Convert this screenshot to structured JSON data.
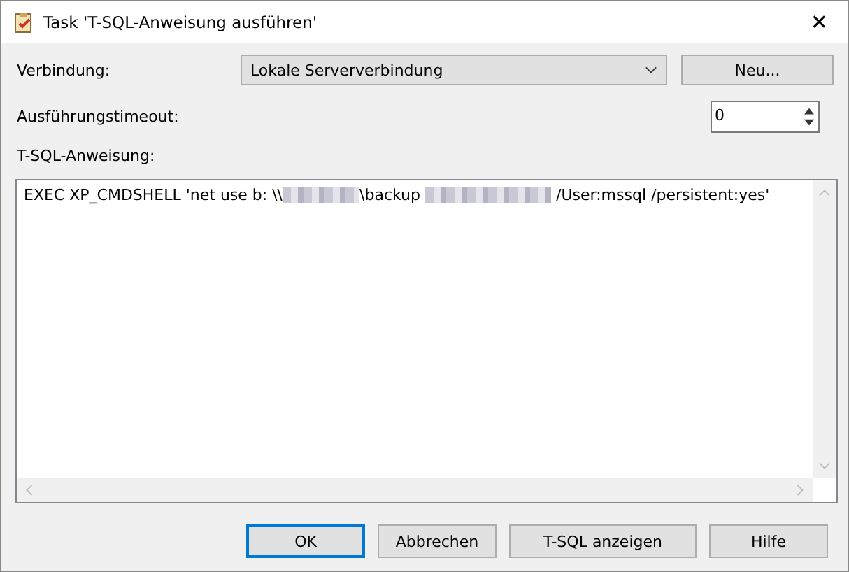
{
  "window": {
    "title": "Task 'T-SQL-Anweisung ausführen'",
    "close": "✕"
  },
  "connection": {
    "label": "Verbindung:",
    "value": "Lokale Serververbindung",
    "new_button": "Neu..."
  },
  "timeout": {
    "label": "Ausführungstimeout:",
    "value": "0"
  },
  "statement": {
    "label": "T-SQL-Anweisung:",
    "segments": [
      {
        "kind": "text",
        "text": "EXEC XP_CMDSHELL 'net use b: \\\\"
      },
      {
        "kind": "redacted"
      },
      {
        "kind": "text",
        "text": "\\backup "
      },
      {
        "kind": "redacted"
      },
      {
        "kind": "text",
        "text": " /User:mssql /persistent:yes'"
      }
    ]
  },
  "buttons": [
    {
      "label": "OK",
      "default": true
    },
    {
      "label": "Abbrechen",
      "default": false
    },
    {
      "label": "T-SQL anzeigen",
      "default": false
    },
    {
      "label": "Hilfe",
      "default": false
    }
  ]
}
